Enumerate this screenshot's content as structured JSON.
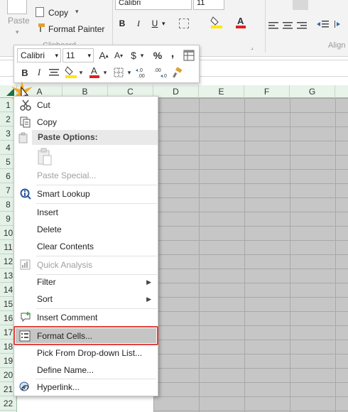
{
  "ribbon": {
    "paste_label": "Paste",
    "copy_label": "Copy",
    "format_painter_label": "Format Painter",
    "clipboard_group": "Clipboard",
    "font_name": "Calibri",
    "font_size": "11",
    "align_group": "Align"
  },
  "mini_toolbar": {
    "font_name": "Calibri",
    "font_size": "11",
    "grow_font": "A",
    "shrink_font": "A",
    "currency": "$",
    "percent": "%",
    "comma": ",",
    "bold": "B",
    "italic": "I",
    "font_color_letter": "A",
    "increase_decimal": "←.0 .00",
    "decrease_decimal": ".00 →.0"
  },
  "columns": [
    "A",
    "B",
    "C",
    "D",
    "E",
    "F",
    "G"
  ],
  "rows": [
    "1",
    "2",
    "3",
    "4",
    "5",
    "6",
    "7",
    "8",
    "9",
    "10",
    "11",
    "12",
    "13",
    "14",
    "15",
    "16",
    "17",
    "18",
    "19",
    "20",
    "21",
    "22"
  ],
  "context_menu": {
    "cut": "Cut",
    "copy": "Copy",
    "paste_options": "Paste Options:",
    "paste_special": "Paste Special...",
    "smart_lookup": "Smart Lookup",
    "insert": "Insert",
    "delete": "Delete",
    "clear_contents": "Clear Contents",
    "quick_analysis": "Quick Analysis",
    "filter": "Filter",
    "sort": "Sort",
    "insert_comment": "Insert Comment",
    "format_cells": "Format Cells...",
    "pick_from_list": "Pick From Drop-down List...",
    "define_name": "Define Name...",
    "hyperlink": "Hyperlink..."
  },
  "colors": {
    "highlight_border": "#e0433d",
    "font_color_red": "#e02020",
    "fill_yellow": "#ffe800",
    "header_green": "#e8f3ea"
  }
}
